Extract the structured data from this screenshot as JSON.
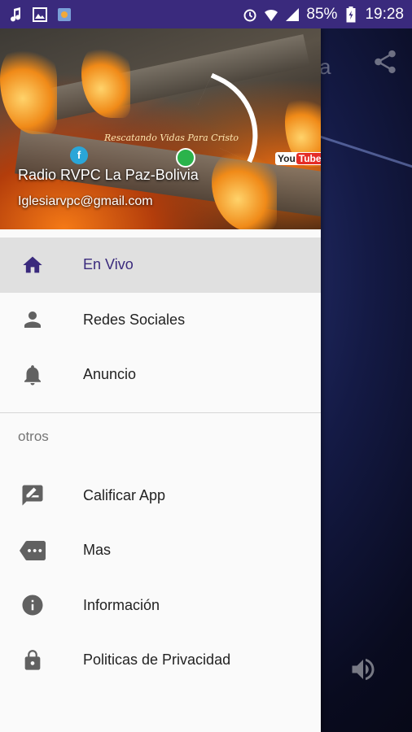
{
  "status_bar": {
    "battery": "85%",
    "time": "19:28",
    "icons": [
      "music-note-icon",
      "image-icon",
      "app-notification-icon",
      "alarm-icon",
      "wifi-icon",
      "signal-icon",
      "battery-icon"
    ]
  },
  "background_app": {
    "title_fragment": "a",
    "icons": [
      "share-icon",
      "volume-icon"
    ]
  },
  "drawer": {
    "header": {
      "title": "Radio RVPC La Paz-Bolivia",
      "email": "Iglesiarvpc@gmail.com",
      "banner_text": "Rescatando Vidas Para Cristo",
      "youtube_label": "You",
      "youtube_tube": "Tube"
    },
    "items": [
      {
        "label": "En Vivo",
        "icon": "home-icon",
        "active": true
      },
      {
        "label": "Redes Sociales",
        "icon": "person-icon",
        "active": false
      },
      {
        "label": "Anuncio",
        "icon": "bell-icon",
        "active": false
      }
    ],
    "section_label": "otros",
    "other_items": [
      {
        "label": "Calificar App",
        "icon": "rate-review-icon"
      },
      {
        "label": "Mas",
        "icon": "more-label-icon"
      },
      {
        "label": "Información",
        "icon": "info-icon"
      },
      {
        "label": "Politicas de Privacidad",
        "icon": "lock-icon"
      }
    ]
  },
  "colors": {
    "status_bar": "#3a2a7d",
    "active_item_bg": "#e0e0e0",
    "active_text": "#3a2a7d",
    "icon_gray": "#616161"
  }
}
